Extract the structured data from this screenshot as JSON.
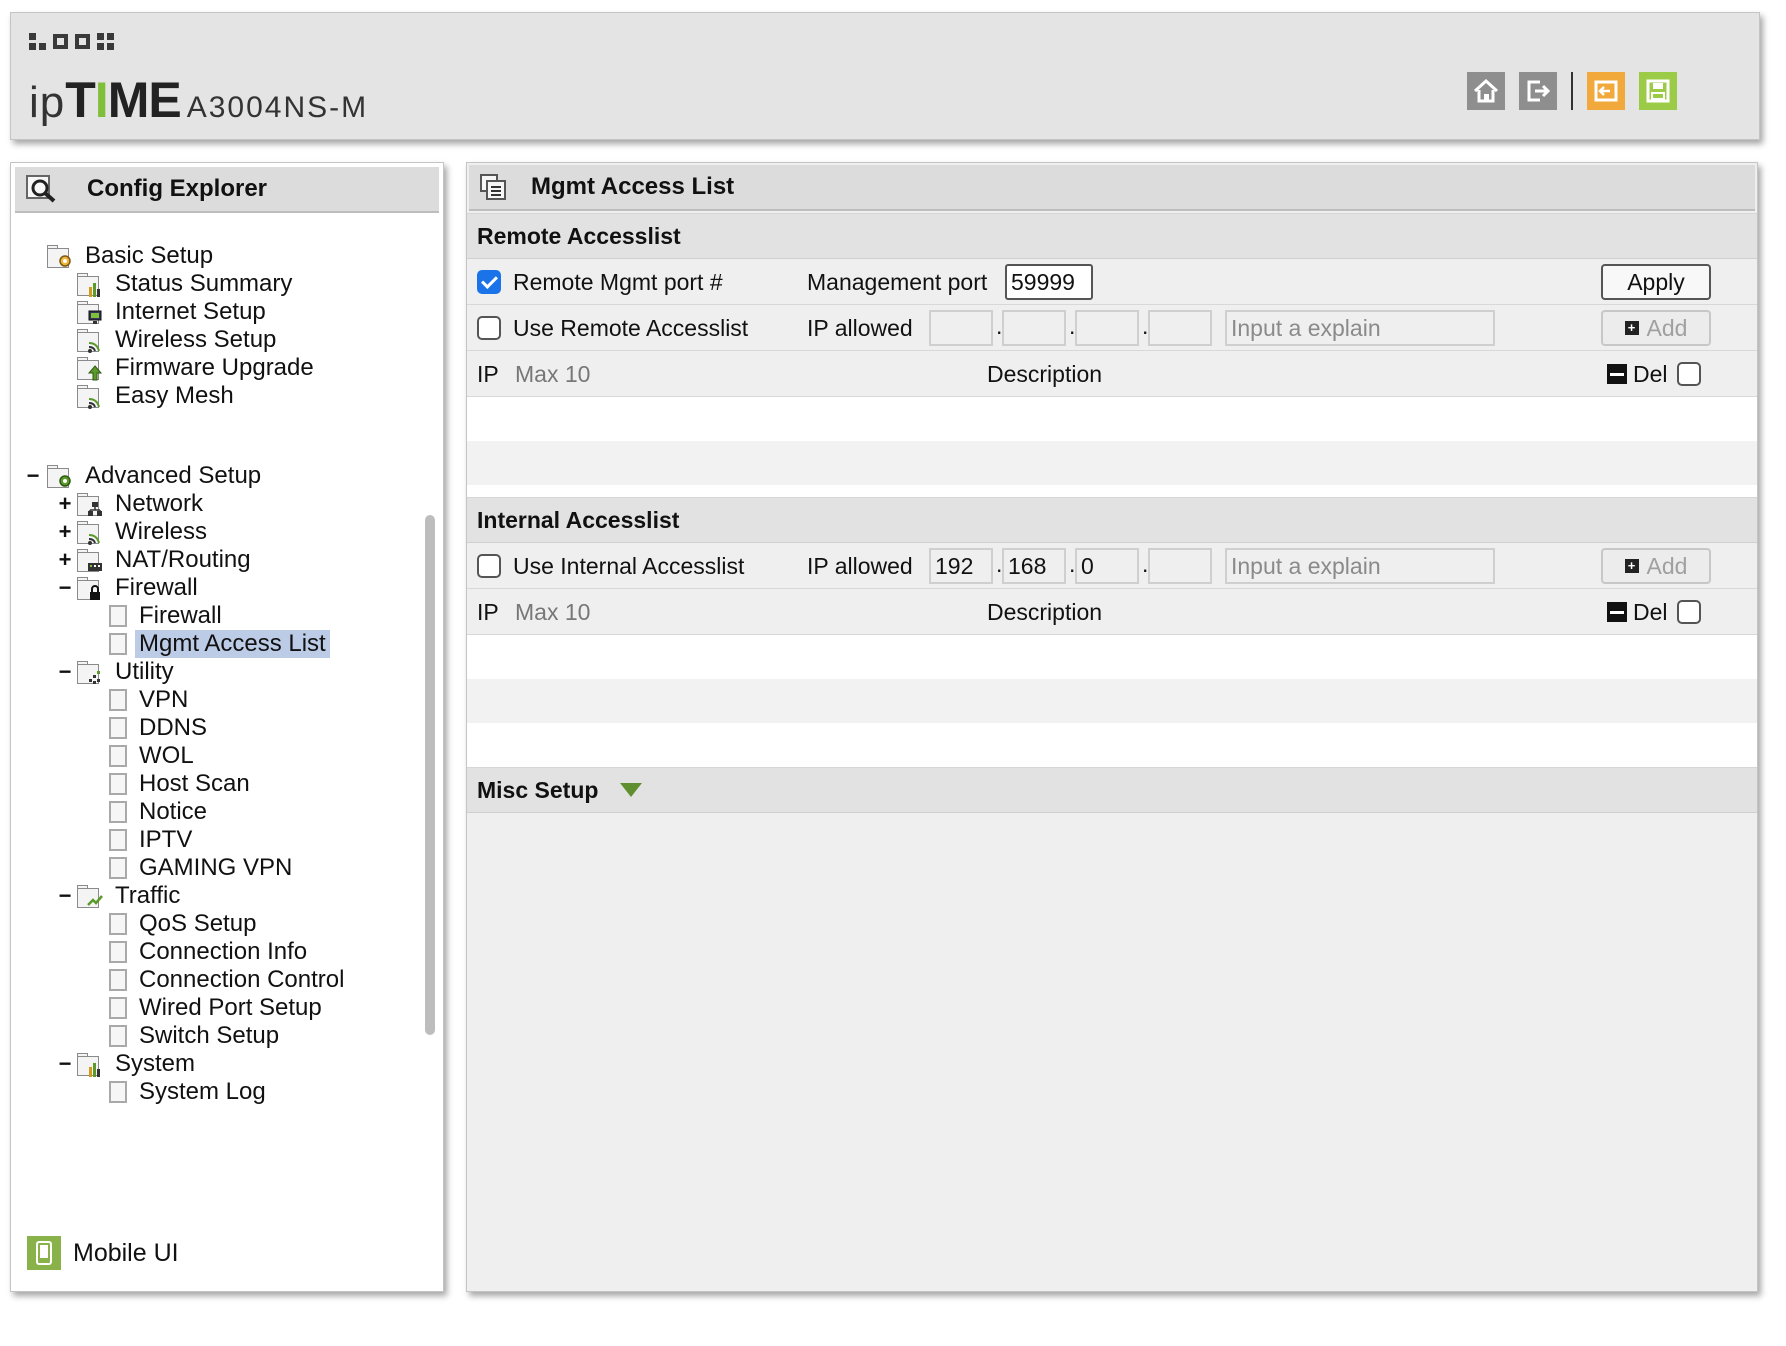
{
  "header": {
    "logo_ip": "ip",
    "logo_t": "T",
    "logo_i": "I",
    "logo_me": "ME",
    "model": "A3004NS-M",
    "toolbar": [
      "home-icon",
      "logout-icon",
      "restore-icon",
      "save-icon"
    ]
  },
  "explorer": {
    "title": "Config Explorer",
    "basic_setup": {
      "label": "Basic Setup",
      "items": [
        "Status Summary",
        "Internet Setup",
        "Wireless Setup",
        "Firmware Upgrade",
        "Easy Mesh"
      ]
    },
    "advanced_setup": {
      "label": "Advanced Setup",
      "network": "Network",
      "wireless": "Wireless",
      "nat_routing": "NAT/Routing",
      "firewall": {
        "label": "Firewall",
        "items": [
          "Firewall",
          "Mgmt Access List"
        ]
      },
      "utility": {
        "label": "Utility",
        "items": [
          "VPN",
          "DDNS",
          "WOL",
          "Host Scan",
          "Notice",
          "IPTV",
          "GAMING VPN"
        ]
      },
      "traffic": {
        "label": "Traffic",
        "items": [
          "QoS Setup",
          "Connection Info",
          "Connection Control",
          "Wired Port Setup",
          "Switch Setup"
        ]
      },
      "system": {
        "label": "System",
        "items": [
          "System Log"
        ]
      }
    },
    "selected": "Mgmt Access List",
    "mobile_ui": "Mobile UI"
  },
  "main": {
    "title": "Mgmt Access List",
    "remote": {
      "heading": "Remote Accesslist",
      "port_label": "Remote Mgmt port #",
      "port_checked": true,
      "mgmt_port_label": "Management port",
      "mgmt_port_value": "59999",
      "apply_label": "Apply",
      "use_label": "Use Remote Accesslist",
      "use_checked": false,
      "ip_allowed_label": "IP allowed",
      "ip": [
        "",
        "",
        "",
        ""
      ],
      "explain_placeholder": "Input a explain",
      "add_label": "Add",
      "list_ip": "IP",
      "list_max": "Max 10",
      "list_desc": "Description",
      "list_del": "Del"
    },
    "internal": {
      "heading": "Internal Accesslist",
      "use_label": "Use Internal Accesslist",
      "use_checked": false,
      "ip_allowed_label": "IP allowed",
      "ip": [
        "192",
        "168",
        "0",
        ""
      ],
      "explain_placeholder": "Input a explain",
      "add_label": "Add",
      "list_ip": "IP",
      "list_max": "Max 10",
      "list_desc": "Description",
      "list_del": "Del"
    },
    "misc": {
      "heading": "Misc Setup"
    }
  },
  "colors": {
    "accent_green": "#7fbf3a",
    "checkbox_blue": "#1a73e8",
    "selection": "#bccbe6"
  }
}
